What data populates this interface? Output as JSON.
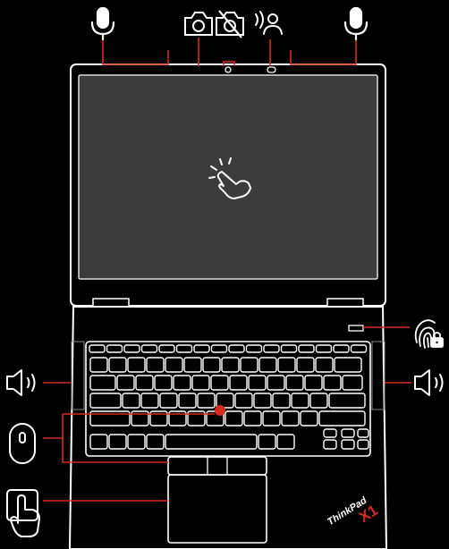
{
  "diagram": {
    "accent_color": "#d62b1f",
    "line_color": "#ffffff",
    "background": "#000000",
    "icons_top": [
      "microphone-icon",
      "camera-icon",
      "camera-off-icon",
      "presence-sensor-icon",
      "microphone-icon"
    ],
    "icons_side": [
      "speaker-icon",
      "speaker-icon",
      "fingerprint-lock-icon",
      "trackpoint-mouse-icon",
      "touchpad-touch-icon"
    ],
    "screen_icon": "touchscreen-tap-icon",
    "brand": {
      "logo_text": "ThinkPad",
      "model_text": "X1"
    }
  }
}
